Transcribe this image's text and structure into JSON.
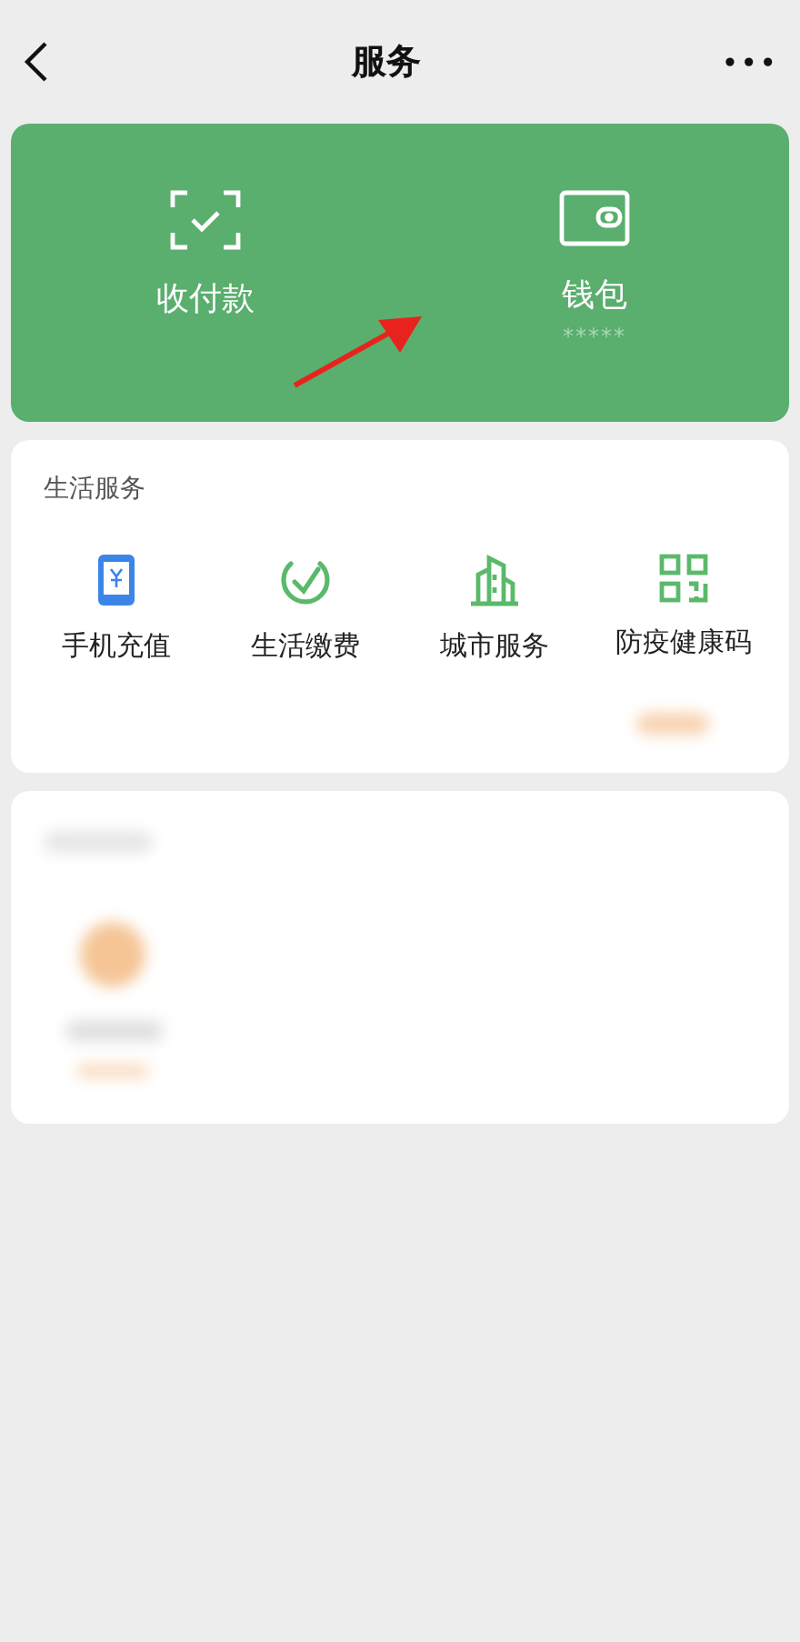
{
  "header": {
    "title": "服务",
    "more": "•••"
  },
  "wallet_panel": {
    "items": [
      {
        "kind": "scan",
        "label": "收付款"
      },
      {
        "kind": "wallet",
        "label": "钱包",
        "sub": "*****"
      }
    ]
  },
  "life_services": {
    "title": "生活服务",
    "items": [
      {
        "kind": "phone",
        "label": "手机充值"
      },
      {
        "kind": "check",
        "label": "生活缴费"
      },
      {
        "kind": "city",
        "label": "城市服务"
      },
      {
        "kind": "qr",
        "label": "防疫健康码"
      }
    ]
  }
}
